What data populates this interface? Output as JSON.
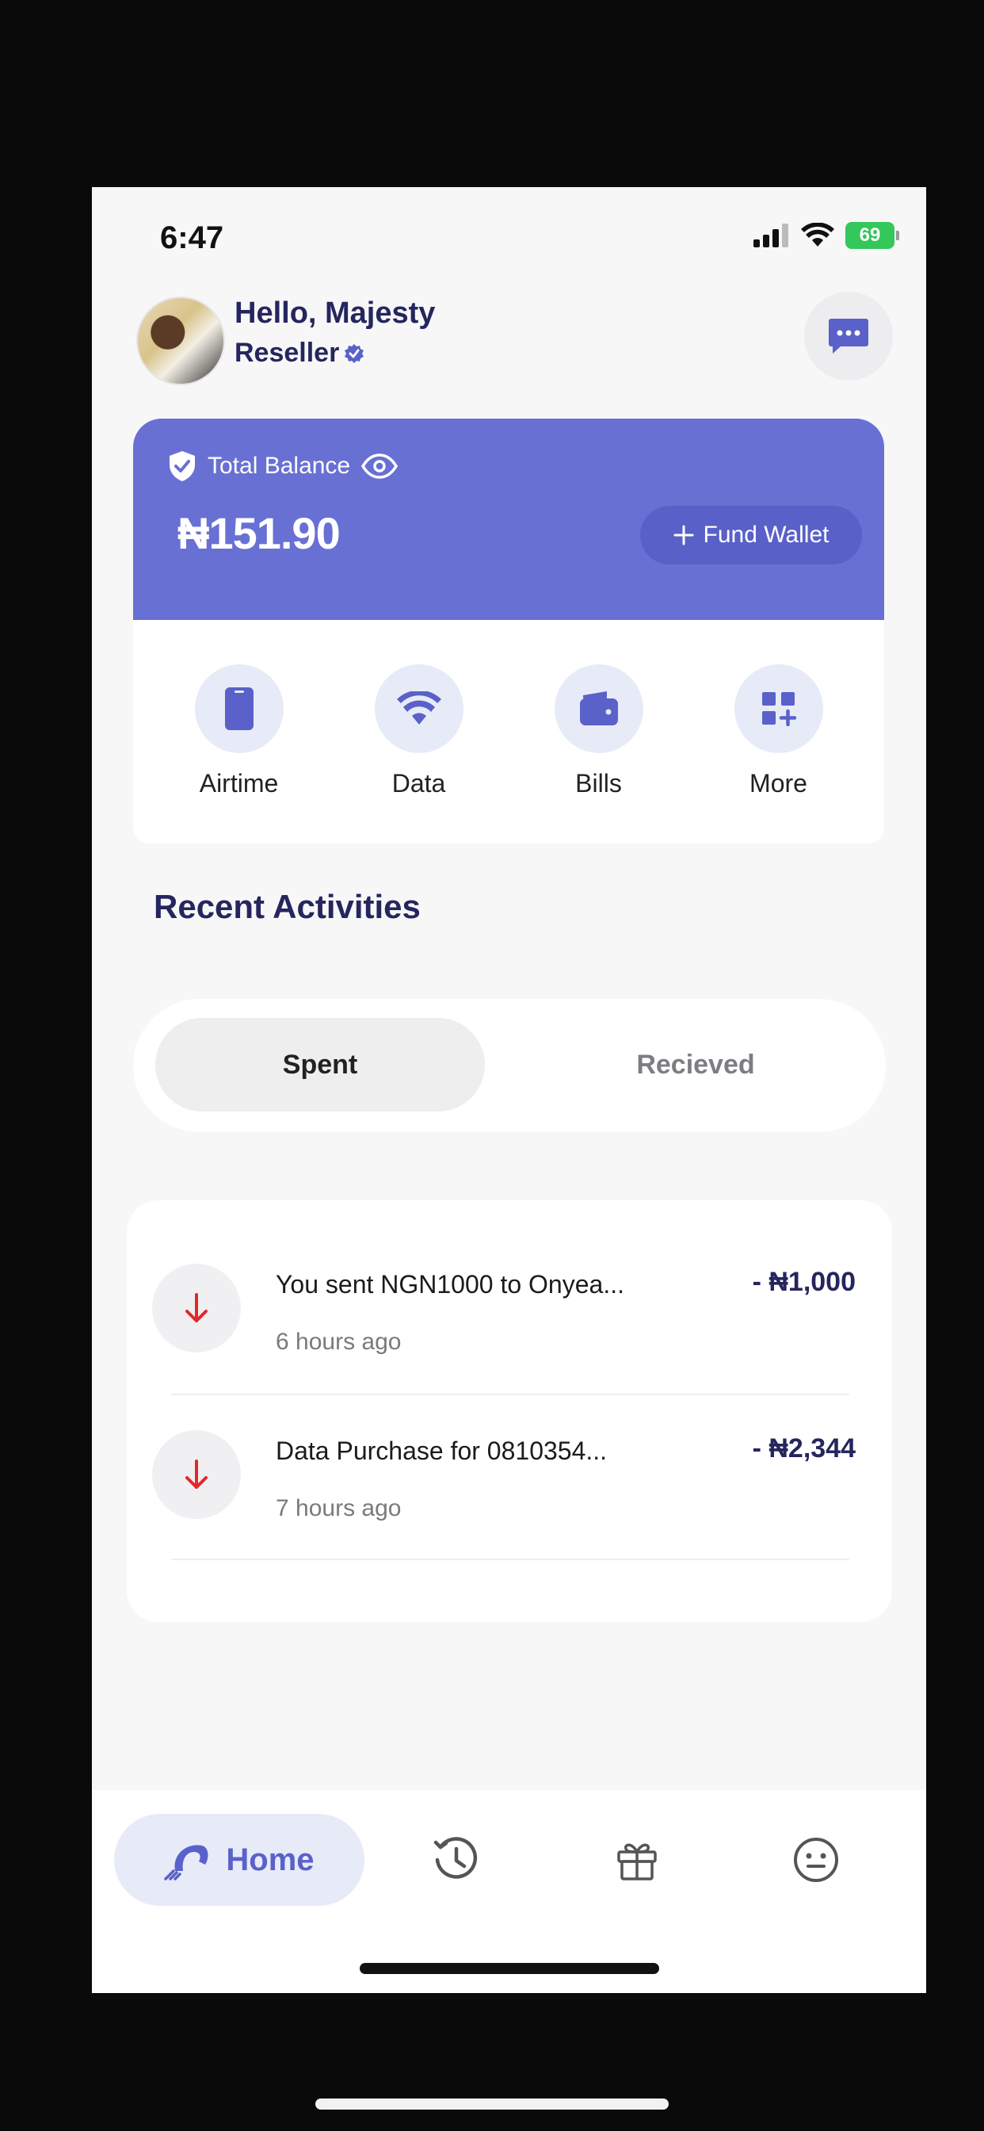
{
  "status_bar": {
    "time": "6:47",
    "battery": "69"
  },
  "header": {
    "greeting": "Hello, Majesty",
    "role": "Reseller"
  },
  "balance": {
    "label": "Total Balance",
    "amount": "₦151.90",
    "fund_wallet_label": "Fund Wallet"
  },
  "quick_actions": [
    {
      "label": "Airtime",
      "icon": "phone-icon"
    },
    {
      "label": "Data",
      "icon": "wifi-icon"
    },
    {
      "label": "Bills",
      "icon": "wallet-icon"
    },
    {
      "label": "More",
      "icon": "grid-plus-icon"
    }
  ],
  "recent": {
    "title": "Recent Activities",
    "tabs": {
      "spent": "Spent",
      "received": "Recieved"
    },
    "transactions": [
      {
        "title": "You sent NGN1000 to Onyea...",
        "time": "6 hours ago",
        "amount": "- ₦1,000"
      },
      {
        "title": "Data Purchase for 0810354...",
        "time": "7 hours ago",
        "amount": "- ₦2,344"
      }
    ]
  },
  "bottom_nav": {
    "home_label": "Home"
  },
  "colors": {
    "accent": "#6870d4",
    "navy": "#25265e",
    "debit": "#e02a2a"
  }
}
